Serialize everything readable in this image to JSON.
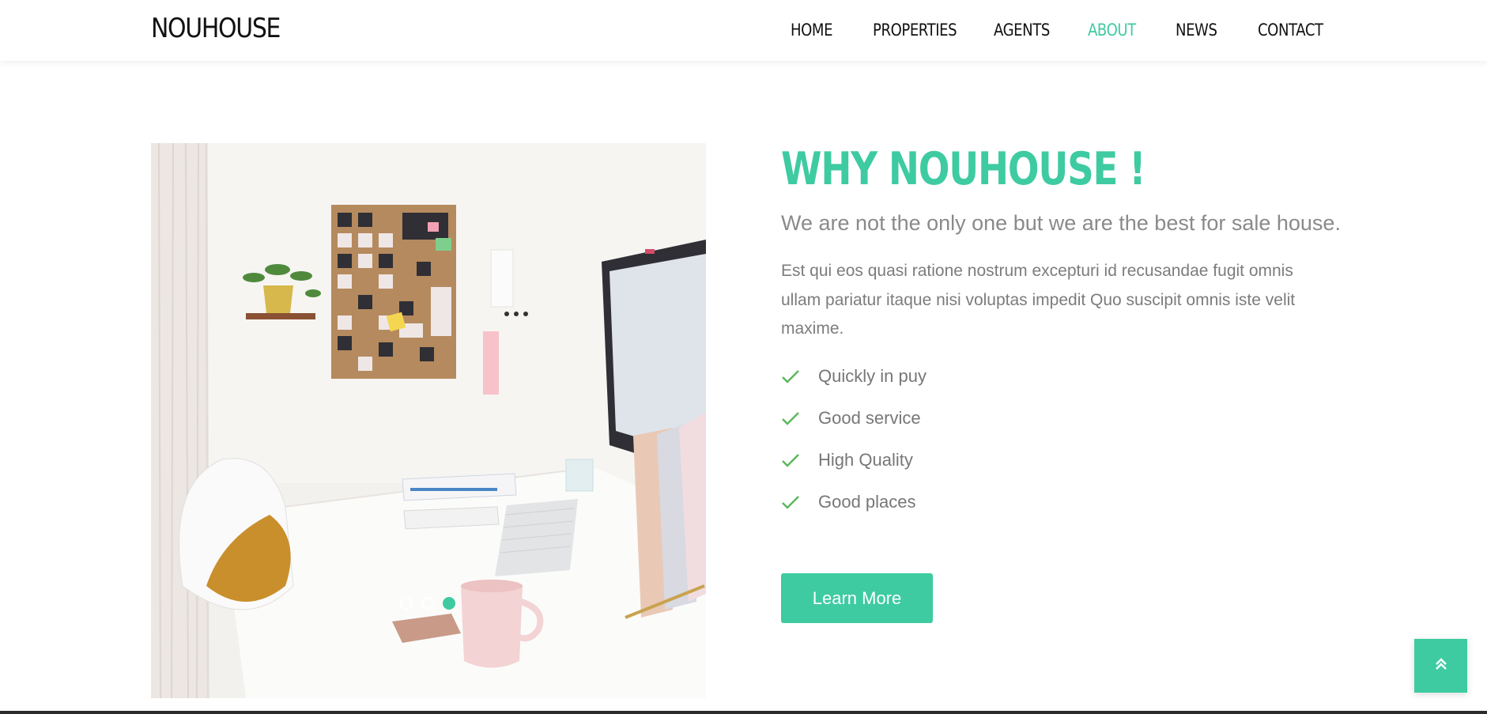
{
  "header": {
    "logo": "NOUHOUSE",
    "nav": [
      {
        "label": "HOME",
        "active": false
      },
      {
        "label": "PROPERTIES",
        "active": false
      },
      {
        "label": "AGENTS",
        "active": false
      },
      {
        "label": "ABOUT",
        "active": true
      },
      {
        "label": "NEWS",
        "active": false
      },
      {
        "label": "CONTACT",
        "active": false
      }
    ]
  },
  "carousel": {
    "image_description": "desk-workspace-photo",
    "slide_count": 3,
    "active_slide": 3
  },
  "about": {
    "heading": "WHY NOUHOUSE !",
    "subheading": "We are not the only one but we are the best for sale house.",
    "paragraph": "Est qui eos quasi ratione nostrum excepturi id recusandae fugit omnis ullam pariatur itaque nisi voluptas impedit Quo suscipit omnis iste velit maxime.",
    "features": [
      {
        "label": "Quickly in puy",
        "icon": "check-icon"
      },
      {
        "label": "Good service",
        "icon": "check-icon"
      },
      {
        "label": "High Quality",
        "icon": "check-icon"
      },
      {
        "label": "Good places",
        "icon": "check-icon"
      }
    ],
    "button_label": "Learn More"
  },
  "back_to_top": {
    "icon": "double-chevron-up-icon"
  },
  "colors": {
    "accent": "#3ecba1",
    "check": "#5cb85c",
    "text_muted": "#7c7c7c"
  }
}
